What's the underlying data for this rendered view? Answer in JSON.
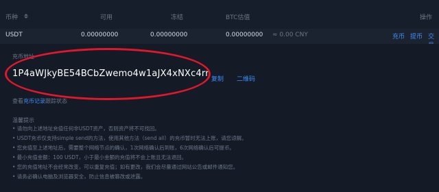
{
  "table": {
    "headers": {
      "coin": "币种",
      "available": "可用",
      "frozen": "冻结",
      "btc_value": "BTC估值",
      "actions": "操作"
    },
    "row": {
      "coin": "USDT",
      "available": "0.00000000",
      "frozen": "0.00000000",
      "btc_value": "0.00000000",
      "cny_value": "≈ 0.00 CNY",
      "deposit": "充币",
      "withdraw": "提币",
      "trade": "交易"
    }
  },
  "deposit": {
    "address_label": "充币地址",
    "address": "1P4aWJkyBE54BCbZwemo4w1aJX4xNXc4rr",
    "copy": "复制",
    "qrcode": "二维码",
    "record_prefix": "查看",
    "record_link": "充币记录",
    "record_suffix": "跟踪状态"
  },
  "tips": {
    "title": "温馨提示",
    "items": [
      "• 请勿向上述地址充值任何非USDT资产，否则资产将不可找回。",
      "• USDT充币仅支持simple send的方法，使用其他方法（send all）的充币暂时无法上账，请您谅解。",
      "• 您充值至上述地址后，需要整个网络节点的确认，1次网络确认后到账，6次网络确认后可提币。",
      "• 最小充值金额：100 USDT，小于最小金额的充值将不会上账且无法退回。",
      "• 您的充值地址不会经常改变，可以重复充值；如有更改，我们会尽量通过网站公告或邮件通知您。",
      "• 请务必确认电脑及浏览器安全，防止信息被篡改或泄露。"
    ]
  },
  "colors": {
    "background": "#131a26",
    "link": "#3e8ef7",
    "highlight_ellipse": "#e0182c"
  }
}
